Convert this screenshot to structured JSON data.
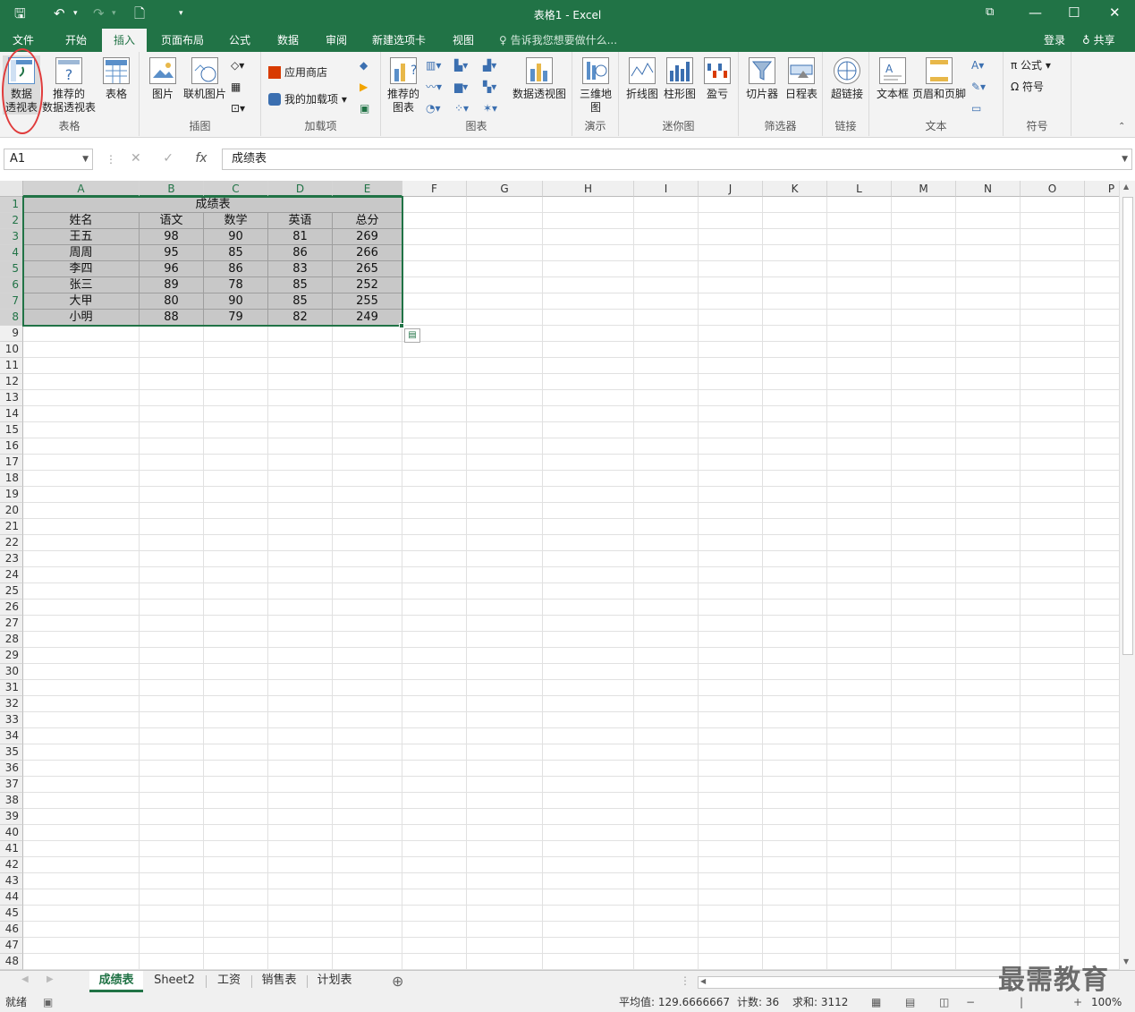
{
  "title": "表格1 - Excel",
  "qa": {
    "save": "🖫",
    "undo": "↶",
    "undo_dd": "▾",
    "redo": "↷",
    "redo_dd": "▾",
    "newdoc": "🗋",
    "custom": "▾"
  },
  "wc": {
    "restore": "⧉",
    "min": "—",
    "max": "☐",
    "close": "✕"
  },
  "tabs": [
    "文件",
    "开始",
    "插入",
    "页面布局",
    "公式",
    "数据",
    "审阅",
    "新建选项卡",
    "视图"
  ],
  "tell_me": "♀ 告诉我您想要做什么...",
  "login": "登录",
  "share": "♁ 共享",
  "ribbon": {
    "groups": [
      "表格",
      "插图",
      "加载项",
      "图表",
      "演示",
      "迷你图",
      "筛选器",
      "链接",
      "文本",
      "符号"
    ],
    "pivot": "数据\n透视表",
    "rec_pivot": "推荐的\n数据透视表",
    "table": "表格",
    "picture": "图片",
    "online_pic": "联机图片",
    "store": "应用商店",
    "myaddins": "我的加载项",
    "rec_chart": "推荐的\n图表",
    "pivotchart": "数据透视图",
    "map3d": "三维地\n图",
    "line": "折线图",
    "column": "柱形图",
    "winloss": "盈亏",
    "slicer": "切片器",
    "timeline": "日程表",
    "hyperlink": "超链接",
    "textbox": "文本框",
    "headerfooter": "页眉和页脚",
    "equation": "π 公式",
    "symbol": "Ω 符号"
  },
  "formula": {
    "namebox": "A1",
    "fx": "fx",
    "value": "成绩表",
    "cancel": "✕",
    "enter": "✓"
  },
  "columns": [
    "A",
    "B",
    "C",
    "D",
    "E",
    "F",
    "G",
    "H",
    "I",
    "J",
    "K",
    "L",
    "M",
    "N",
    "O",
    "P"
  ],
  "sheet": {
    "title": "成绩表",
    "headers": [
      "姓名",
      "语文",
      "数学",
      "英语",
      "总分"
    ],
    "rows": [
      [
        "王五",
        "98",
        "90",
        "81",
        "269"
      ],
      [
        "周周",
        "95",
        "85",
        "86",
        "266"
      ],
      [
        "李四",
        "96",
        "86",
        "83",
        "265"
      ],
      [
        "张三",
        "89",
        "78",
        "85",
        "252"
      ],
      [
        "大甲",
        "80",
        "90",
        "85",
        "255"
      ],
      [
        "小明",
        "88",
        "79",
        "82",
        "249"
      ]
    ]
  },
  "sheet_tabs": [
    "成绩表",
    "Sheet2",
    "工资",
    "销售表",
    "计划表"
  ],
  "add_sheet": "⊕",
  "status": {
    "ready": "就绪",
    "average": "平均值: 129.6666667",
    "count": "计数: 36",
    "sum": "求和: 3112",
    "zoom": "100%"
  },
  "watermark": "最需教育",
  "colors": {
    "accent": "#217346",
    "annotation": "#e03b3b"
  }
}
